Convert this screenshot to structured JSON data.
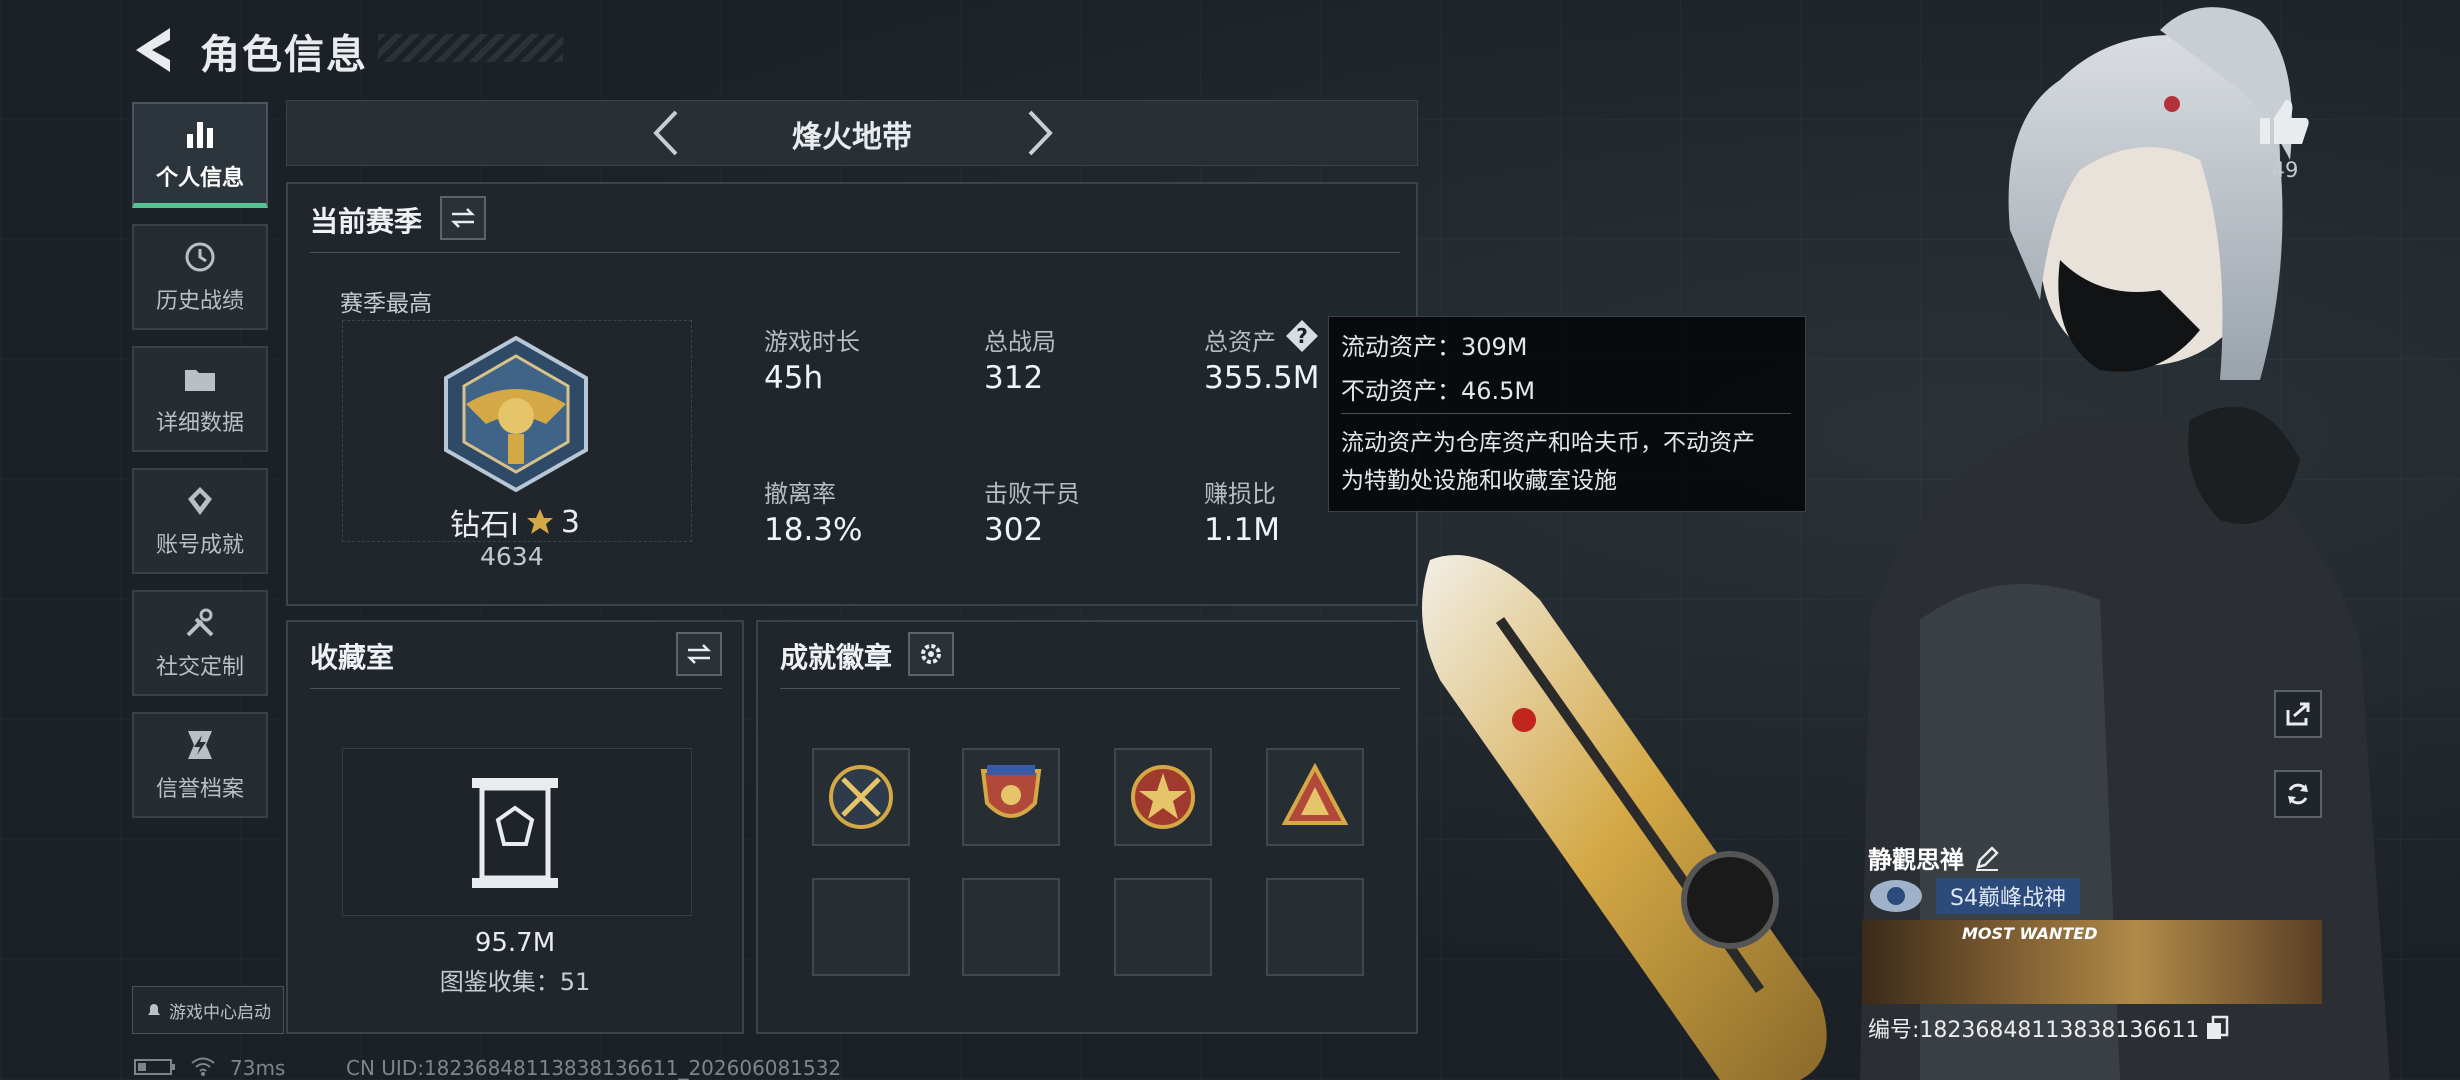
{
  "header": {
    "title": "角色信息"
  },
  "sidebar": {
    "items": [
      {
        "label": "个人信息"
      },
      {
        "label": "历史战绩"
      },
      {
        "label": "详细数据"
      },
      {
        "label": "账号成就"
      },
      {
        "label": "社交定制"
      },
      {
        "label": "信誉档案"
      }
    ],
    "launch_label": "游戏中心启动"
  },
  "mode": {
    "title": "烽火地带"
  },
  "season": {
    "title": "当前赛季",
    "best_label": "赛季最高",
    "rank_name": "钻石Ⅰ",
    "rank_stars": "3",
    "rank_points": "4634",
    "stats": [
      {
        "label": "游戏时长",
        "value": "45h"
      },
      {
        "label": "总战局",
        "value": "312"
      },
      {
        "label": "总资产",
        "value": "355.5M"
      },
      {
        "label": "撤离率",
        "value": "18.3%"
      },
      {
        "label": "击败干员",
        "value": "302"
      },
      {
        "label": "赚损比",
        "value": "1.1M"
      }
    ]
  },
  "tooltip": {
    "line1": "流动资产：309M",
    "line2": "不动资产：46.5M",
    "desc1": "流动资产为仓库资产和哈夫币，不动资产",
    "desc2": "为特勤处设施和收藏室设施"
  },
  "collection": {
    "title": "收藏室",
    "value": "95.7M",
    "count_text": "图鉴收集：51"
  },
  "badges": {
    "title": "成就徽章"
  },
  "likes": {
    "count": "49"
  },
  "player": {
    "name": "静觀思禅",
    "title_badge": "S4巅峰战神",
    "card_banner": "MOST WANTED",
    "id_text": "编号:18236848113838136611"
  },
  "footer": {
    "ping": "73ms",
    "uid": "CN UID:18236848113838136611_202606081532"
  },
  "colors": {
    "accent_green": "#56c490",
    "gold": "#d4a845"
  }
}
